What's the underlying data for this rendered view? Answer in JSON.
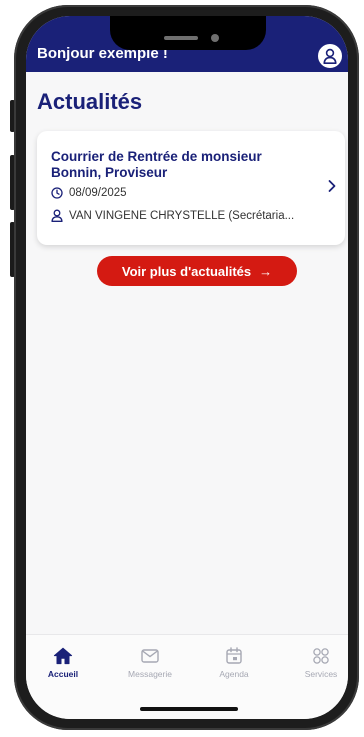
{
  "header": {
    "greeting": "Bonjour exemple !"
  },
  "page_title": "Actualités",
  "news": [
    {
      "title": "Courrier de Rentrée de monsieur Bonnin, Proviseur",
      "date": "08/09/2025",
      "author": "VAN VINGENE CHRYSTELLE (Secrétaria..."
    }
  ],
  "more_button": {
    "label": "Voir plus d'actualités",
    "arrow": "→"
  },
  "tabs": [
    {
      "label": "Accueil",
      "icon": "home-icon",
      "active": true
    },
    {
      "label": "Messagerie",
      "icon": "envelope-icon",
      "active": false
    },
    {
      "label": "Agenda",
      "icon": "calendar-icon",
      "active": false
    },
    {
      "label": "Services",
      "icon": "grid-icon",
      "active": false
    }
  ],
  "colors": {
    "brand": "#1a2178",
    "accent": "#d41a12",
    "inactive_tab": "#a6a8b3"
  }
}
